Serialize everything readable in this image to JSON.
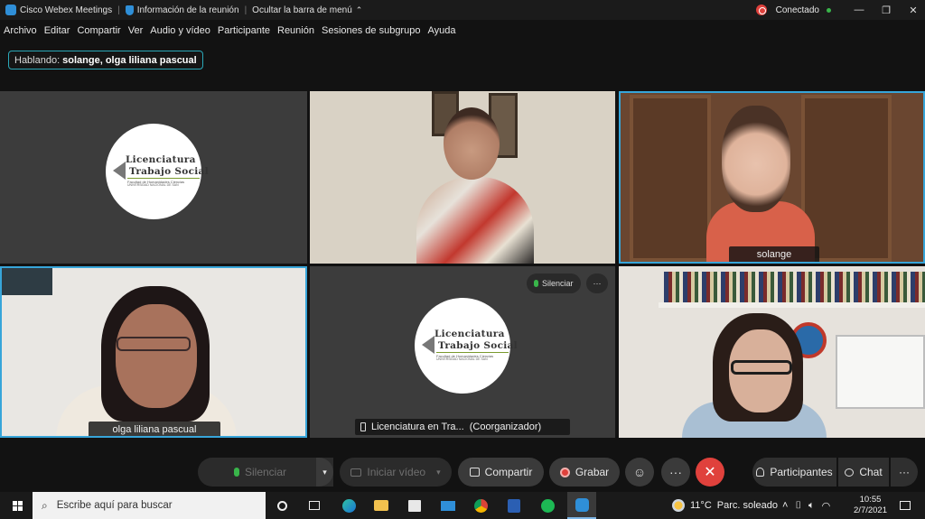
{
  "titlebar": {
    "app_name": "Cisco Webex Meetings",
    "meeting_info": "Información de la reunión",
    "hide_menu": "Ocultar la barra de menú",
    "status": "Conectado",
    "status_color": "#39b54a"
  },
  "menu": {
    "items": [
      "Archivo",
      "Editar",
      "Compartir",
      "Ver",
      "Audio y vídeo",
      "Participante",
      "Reunión",
      "Sesiones de subgrupo",
      "Ayuda"
    ]
  },
  "speaking": {
    "label": "Hablando:",
    "names": "solange, olga liliana pascual"
  },
  "tiles": {
    "logo1": {
      "line1": "Licenciatura",
      "line2": "Trabajo Social",
      "line3": "Facultad de Humanidades Ciencias",
      "line4": "UNIVERSIDAD NACIONAL DE SAN"
    },
    "solange": {
      "name": "solange"
    },
    "olga": {
      "name": "olga liliana pascual"
    },
    "cohost": {
      "name": "Licenciatura en Tra...",
      "role": "(Coorganizador)",
      "mute_label": "Silenciar",
      "more": "···"
    },
    "logo2": {
      "line1": "Licenciatura",
      "line2": "Trabajo Social",
      "line3": "Facultad de Humanidades Ciencias",
      "line4": "UNIVERSIDAD NACIONAL DE SAN"
    }
  },
  "controls": {
    "mute": "Silenciar",
    "video": "Iniciar vídeo",
    "share": "Compartir",
    "record": "Grabar",
    "more": "···",
    "leave": "✕",
    "participants": "Participantes",
    "chat": "Chat",
    "panel_more": "···"
  },
  "taskbar": {
    "search_placeholder": "Escribe aquí para buscar",
    "weather_temp": "11°C",
    "weather_desc": "Parc. soleado",
    "time": "10:55",
    "date": "2/7/2021"
  },
  "colors": {
    "accent_blue": "#37a5d9",
    "leave_red": "#e0413c",
    "background": "#121212"
  }
}
